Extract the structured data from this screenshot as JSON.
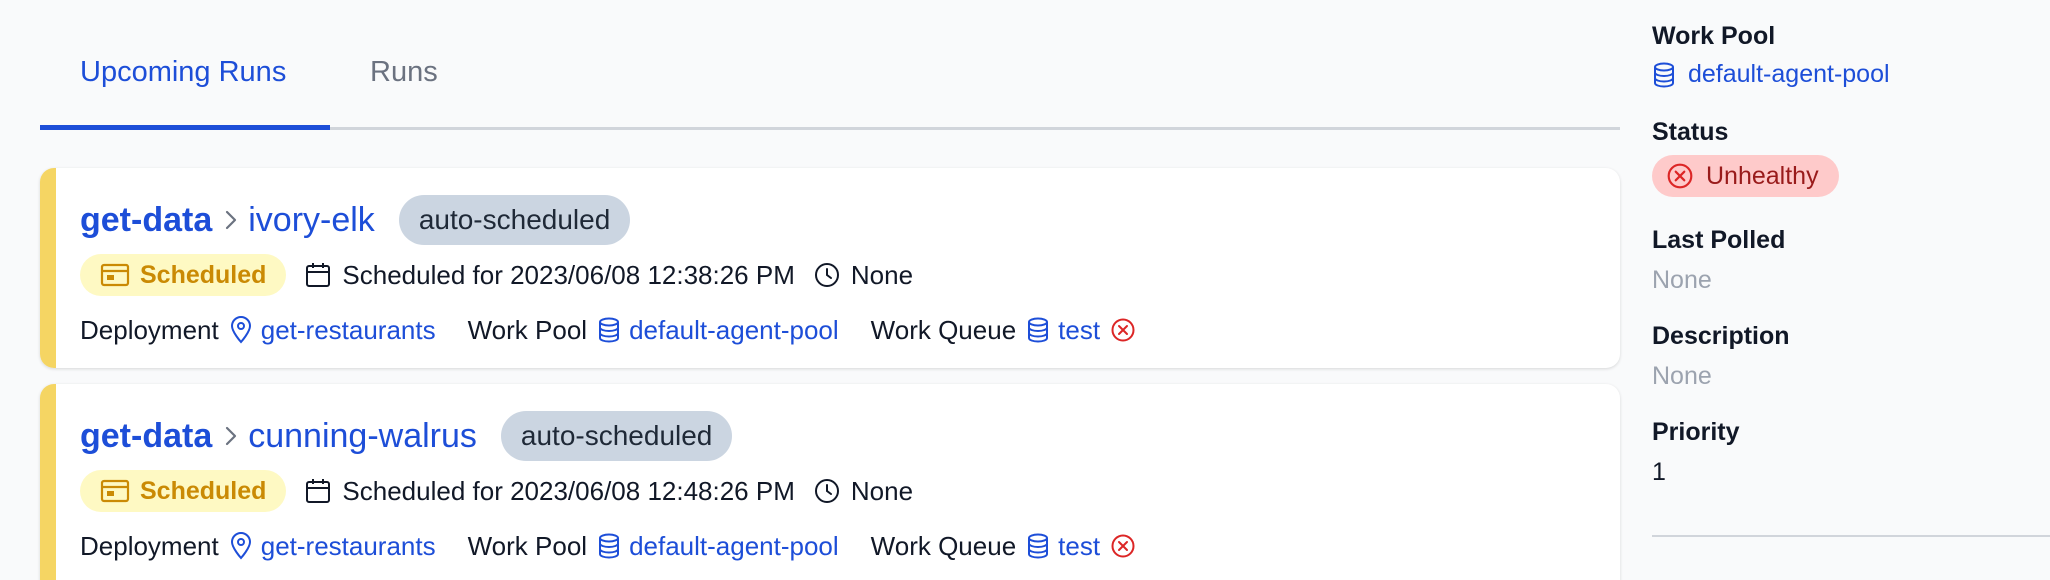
{
  "tabs": [
    {
      "label": "Upcoming Runs",
      "active": true
    },
    {
      "label": "Runs",
      "active": false
    }
  ],
  "runs": [
    {
      "flow": "get-data",
      "run": "ivory-elk",
      "tag": "auto-scheduled",
      "state": "Scheduled",
      "scheduled": "Scheduled for 2023/06/08 12:38:26 PM",
      "duration": "None",
      "deployment_label": "Deployment",
      "deployment": "get-restaurants",
      "work_pool_label": "Work Pool",
      "work_pool": "default-agent-pool",
      "work_queue_label": "Work Queue",
      "work_queue": "test"
    },
    {
      "flow": "get-data",
      "run": "cunning-walrus",
      "tag": "auto-scheduled",
      "state": "Scheduled",
      "scheduled": "Scheduled for 2023/06/08 12:48:26 PM",
      "duration": "None",
      "deployment_label": "Deployment",
      "deployment": "get-restaurants",
      "work_pool_label": "Work Pool",
      "work_pool": "default-agent-pool",
      "work_queue_label": "Work Queue",
      "work_queue": "test"
    }
  ],
  "sidebar": {
    "work_pool_label": "Work Pool",
    "work_pool": "default-agent-pool",
    "status_label": "Status",
    "status": "Unhealthy",
    "last_polled_label": "Last Polled",
    "last_polled": "None",
    "description_label": "Description",
    "description": "None",
    "priority_label": "Priority",
    "priority": "1"
  },
  "colors": {
    "accent": "#1d4ed8",
    "scheduled_bar": "#f5d563",
    "scheduled_badge_bg": "#fef9c3",
    "scheduled_badge_text": "#ca8a04",
    "unhealthy_bg": "#fecaca",
    "unhealthy_text": "#991b1b",
    "error_icon": "#dc2626"
  },
  "icons": {
    "state": "calendar-card-icon",
    "scheduled": "calendar-icon",
    "duration": "clock-icon",
    "deployment": "map-pin-icon",
    "work_pool": "database-icon",
    "work_queue": "database-icon",
    "queue_status": "x-circle-icon",
    "status": "x-circle-icon",
    "breadcrumb": "chevron-right-icon"
  }
}
